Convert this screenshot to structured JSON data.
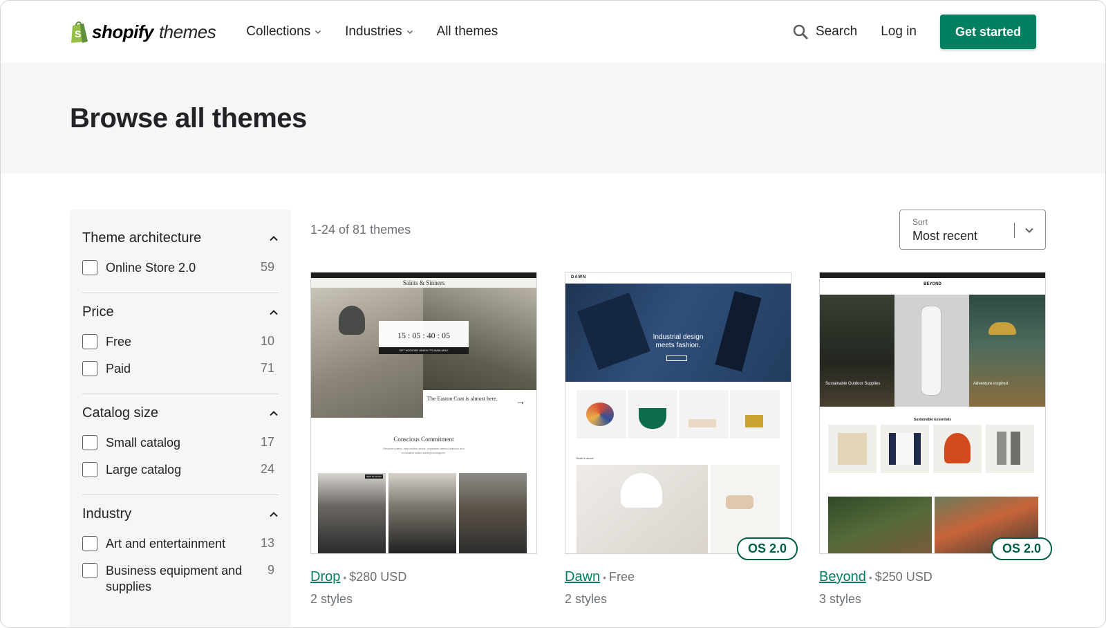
{
  "header": {
    "logo_word": "shopify",
    "logo_sub": "themes",
    "nav": [
      {
        "label": "Collections",
        "dropdown": true
      },
      {
        "label": "Industries",
        "dropdown": true
      },
      {
        "label": "All themes",
        "dropdown": false
      }
    ],
    "search_label": "Search",
    "login_label": "Log in",
    "cta_label": "Get started"
  },
  "hero": {
    "title": "Browse all themes"
  },
  "filters": {
    "architecture": {
      "title": "Theme architecture",
      "options": [
        {
          "label": "Online Store 2.0",
          "count": "59"
        }
      ]
    },
    "price": {
      "title": "Price",
      "options": [
        {
          "label": "Free",
          "count": "10"
        },
        {
          "label": "Paid",
          "count": "71"
        }
      ]
    },
    "catalog": {
      "title": "Catalog size",
      "options": [
        {
          "label": "Small catalog",
          "count": "17"
        },
        {
          "label": "Large catalog",
          "count": "24"
        }
      ]
    },
    "industry": {
      "title": "Industry",
      "options": [
        {
          "label": "Art and entertainment",
          "count": "13"
        },
        {
          "label": "Business equipment and supplies",
          "count": "9"
        }
      ]
    }
  },
  "results": {
    "summary": "1-24 of 81 themes"
  },
  "sort": {
    "label": "Sort",
    "value": "Most recent"
  },
  "themes": [
    {
      "name": "Drop",
      "price": "$280 USD",
      "styles": "2 styles",
      "badge": "",
      "preview": {
        "store_name": "Saints & Sinners",
        "countdown": "15 : 05 : 40 : 05",
        "notify": "GET NOTIFIED WHEN IT'S AVAILABLE",
        "product_text": "The Easton Coat is almost here.",
        "section_title": "Conscious Commitment",
        "section_body": "Recycled yarns, responsible wools, vegetable-tanned leathers and innovative water-saving techniques.",
        "tag": "NEW IN STOCK"
      }
    },
    {
      "name": "Dawn",
      "price": "Free",
      "styles": "2 styles",
      "badge": "OS 2.0",
      "preview": {
        "brand": "DAWN",
        "hero_text": "Industrial design meets fashion.",
        "section_label": "Back in stock!"
      }
    },
    {
      "name": "Beyond",
      "price": "$250 USD",
      "styles": "3 styles",
      "badge": "OS 2.0",
      "preview": {
        "brand": "BEYOND",
        "left_caption": "Sustainable Outdoor Supplies",
        "right_caption": "Adventure inspired",
        "section_title": "Sustainable Essentials"
      }
    }
  ],
  "colors": {
    "accent": "#008060",
    "hero_bg": "#f6f6f7",
    "badge": "#005e46"
  }
}
